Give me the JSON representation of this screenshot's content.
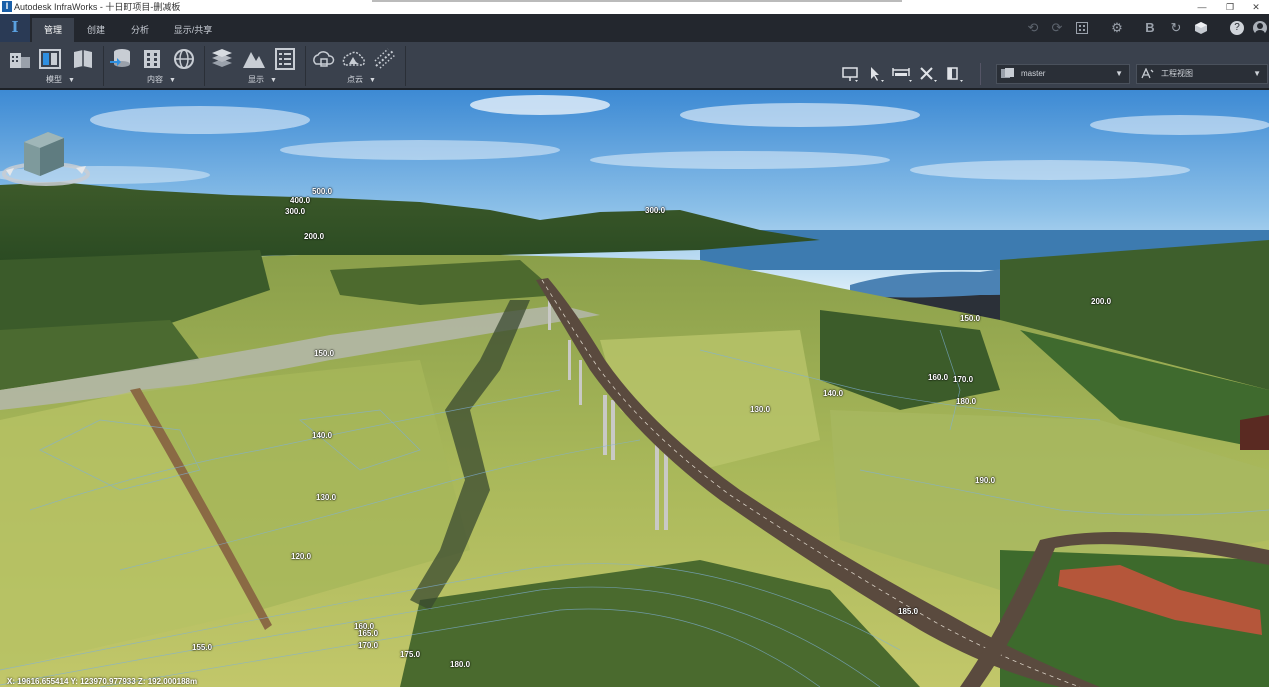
{
  "window": {
    "title": "Autodesk InfraWorks - 十日町项目-删减板",
    "controls": [
      "—",
      "❐",
      "✕"
    ]
  },
  "tabs": [
    {
      "label": "管理",
      "active": true
    },
    {
      "label": "创建",
      "active": false
    },
    {
      "label": "分析",
      "active": false
    },
    {
      "label": "显示/共享",
      "active": false
    }
  ],
  "quick_access": {
    "undo_icon": "undo-icon",
    "redo_icon": "redo-icon",
    "layout_icon": "grid-icon",
    "settings_icon": "gear-icon",
    "b_label": "B",
    "refresh_icon": "refresh-icon",
    "cube_icon": "cube-icon",
    "help_label": "?",
    "user_icon": "avatar-icon"
  },
  "ribbon": {
    "groups": [
      {
        "label": "模型"
      },
      {
        "label": "内容"
      },
      {
        "label": "显示"
      },
      {
        "label": "点云"
      }
    ],
    "version_dropdown": {
      "value": "master"
    },
    "view_dropdown": {
      "value": "工程视图"
    }
  },
  "viewport": {
    "elevation_labels": [
      "500.0",
      "400.0",
      "300.0",
      "200.0",
      "300.0",
      "200.0",
      "150.0",
      "150.0",
      "160.0",
      "170.0",
      "180.0",
      "140.0",
      "130.0",
      "140.0",
      "130.0",
      "120.0",
      "190.0",
      "185.0",
      "160.0",
      "165.0",
      "170.0",
      "175.0",
      "180.0",
      "155.0"
    ],
    "coordinates": "X: 19616.655414 Y: 123970.977933 Z: 192.000188m"
  },
  "colors": {
    "accent": "#1a5fa8",
    "ribbon": "#3a414d",
    "tabrow": "#23272e"
  }
}
